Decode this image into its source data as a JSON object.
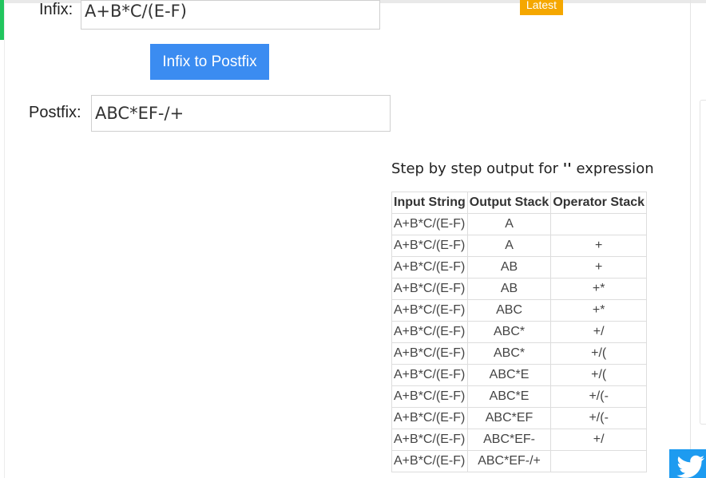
{
  "badge": {
    "latest": "Latest"
  },
  "converter": {
    "infix_label": "Infix:",
    "infix_value": "A+B*C/(E-F)",
    "button_label": "Infix to Postfix",
    "postfix_label": "Postfix:",
    "postfix_value": "ABC*EF-/+"
  },
  "steps": {
    "title_prefix": "Step by step output for",
    "title_quote": "''",
    "title_suffix": "expression",
    "headers": [
      "Input String",
      "Output Stack",
      "Operator Stack"
    ],
    "rows": [
      [
        "A+B*C/(E-F)",
        "A",
        ""
      ],
      [
        "A+B*C/(E-F)",
        "A",
        "+"
      ],
      [
        "A+B*C/(E-F)",
        "AB",
        "+"
      ],
      [
        "A+B*C/(E-F)",
        "AB",
        "+*"
      ],
      [
        "A+B*C/(E-F)",
        "ABC",
        "+*"
      ],
      [
        "A+B*C/(E-F)",
        "ABC*",
        "+/"
      ],
      [
        "A+B*C/(E-F)",
        "ABC*",
        "+/("
      ],
      [
        "A+B*C/(E-F)",
        "ABC*E",
        "+/("
      ],
      [
        "A+B*C/(E-F)",
        "ABC*E",
        "+/(-"
      ],
      [
        "A+B*C/(E-F)",
        "ABC*EF",
        "+/(-"
      ],
      [
        "A+B*C/(E-F)",
        "ABC*EF-",
        "+/"
      ],
      [
        "A+B*C/(E-F)",
        "ABC*EF-/+",
        ""
      ]
    ]
  },
  "social": {
    "icon": "twitter-icon"
  },
  "colors": {
    "accent_green": "#22c55e",
    "button_blue": "#3b8cf1",
    "badge_orange": "#f5a700",
    "twitter_blue": "#1d9bf0"
  }
}
